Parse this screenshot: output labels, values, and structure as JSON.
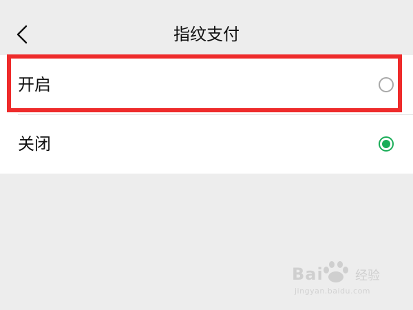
{
  "header": {
    "title": "指纹支付",
    "back_icon": "chevron-left-icon"
  },
  "options": [
    {
      "label": "开启",
      "selected": false
    },
    {
      "label": "关闭",
      "selected": true
    }
  ],
  "colors": {
    "accent": "#1aad58",
    "highlight": "#ee2b2b",
    "background": "#ededed"
  },
  "watermark": {
    "brand": "Bai",
    "brand_suffix": "经验",
    "url": "jingyan.baidu.com"
  }
}
